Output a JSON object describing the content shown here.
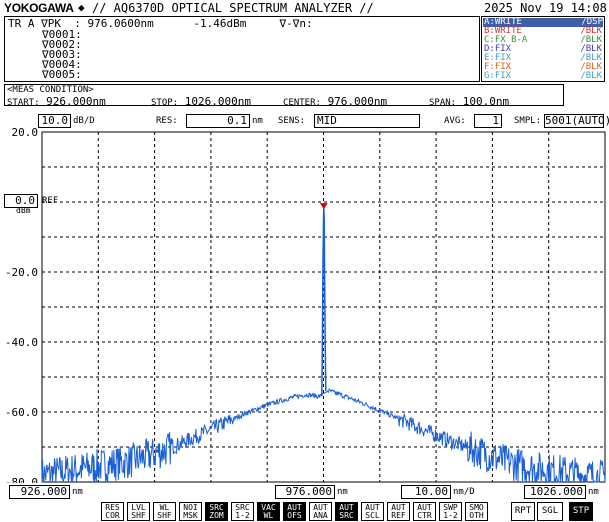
{
  "header": {
    "brand": "YOKOGAWA",
    "title": "// AQ6370D OPTICAL SPECTRUM ANALYZER //",
    "datetime": "2025 Nov 19 14:08"
  },
  "marker": {
    "line1": "TR A ∇PK  : 976.0600nm      -1.46dBm     ∇-∇n:",
    "markers": [
      "∇0001:",
      "∇0002:",
      "∇0003:",
      "∇0004:",
      "∇0005:"
    ]
  },
  "traces": [
    {
      "name": "A:WRITE",
      "mode": "/DSP",
      "color": "#ffffff"
    },
    {
      "name": "B:WRITE",
      "mode": "/BLK",
      "color": "#e03030"
    },
    {
      "name": "C:FX B-A",
      "mode": "/BLK",
      "color": "#3c8f3c"
    },
    {
      "name": "D:FIX",
      "mode": "/BLK",
      "color": "#3c3cc8"
    },
    {
      "name": "E:FIX",
      "mode": "/BLK",
      "color": "#3ca0c8"
    },
    {
      "name": "F:FIX",
      "mode": "/BLK",
      "color": "#e06020"
    },
    {
      "name": "G:FIX",
      "mode": "/BLK",
      "color": "#3ca0c8"
    }
  ],
  "meas": {
    "title": "<MEAS CONDITION>",
    "start_label": "START:",
    "start_value": "926.000",
    "start_unit": "nm",
    "stop_label": "STOP:",
    "stop_value": "1026.000",
    "stop_unit": "nm",
    "center_label": "CENTER:",
    "center_value": "976.000",
    "center_unit": "nm",
    "span_label": "SPAN:",
    "span_value": "100.0",
    "span_unit": "nm"
  },
  "settings": {
    "scale_value": "10.0",
    "scale_unit": "dB/D",
    "res_label": "RES:",
    "res_value": "0.1",
    "res_unit": "nm",
    "sens_label": "SENS:",
    "sens_value": "MID",
    "avg_label": "AVG:",
    "avg_value": "1",
    "smpl_label": "SMPL:",
    "smpl_value": "5001(AUTO)"
  },
  "ref": {
    "value": "0.0",
    "label": "REF",
    "unit": "dBm"
  },
  "bottom": {
    "start": "926.000",
    "start_unit": "nm",
    "center": "976.000",
    "center_unit": "nm",
    "div": "10.00",
    "div_unit": "nm/D",
    "stop": "1026.000",
    "stop_unit": "nm"
  },
  "function_keys": [
    {
      "label": "RES\nCOR",
      "active": false
    },
    {
      "label": "LVL\nSHF",
      "active": false
    },
    {
      "label": "WL\nSHF",
      "active": false
    },
    {
      "label": "NOI\nMSK",
      "active": false
    },
    {
      "label": "SRC\nZOM",
      "active": true
    },
    {
      "label": "SRC\n1-2",
      "active": false
    },
    {
      "label": "VAC\nWL",
      "active": true
    },
    {
      "label": "AUT\nOFS",
      "active": true
    },
    {
      "label": "AUT\nANA",
      "active": false
    },
    {
      "label": "AUT\nSRC",
      "active": true
    },
    {
      "label": "AUT\nSCL",
      "active": false
    },
    {
      "label": "AUT\nREF",
      "active": false
    },
    {
      "label": "AUT\nCTR",
      "active": false
    },
    {
      "label": "SWP\n1-2",
      "active": false
    },
    {
      "label": "SMO\nOTH",
      "active": false
    }
  ],
  "run_keys": [
    {
      "label": "RPT",
      "active": false
    },
    {
      "label": "SGL",
      "active": false
    },
    {
      "label": "STP",
      "active": true
    }
  ],
  "chart_data": {
    "type": "line",
    "xlabel": "nm",
    "ylabel": "dBm",
    "xlim": [
      926.0,
      1026.0
    ],
    "ylim": [
      -80.0,
      20.0
    ],
    "y_ticks": [
      "20.0",
      "0.0",
      "-20.0",
      "-40.0",
      "-60.0",
      "-80.0"
    ],
    "grid": true,
    "peak": {
      "x": 976.06,
      "y": -1.46
    },
    "series": [
      {
        "name": "A",
        "color": "#1a5fd6",
        "points": [
          [
            926.0,
            -78
          ],
          [
            930.0,
            -77
          ],
          [
            934.0,
            -76
          ],
          [
            938.0,
            -75
          ],
          [
            942.0,
            -74
          ],
          [
            946.0,
            -72
          ],
          [
            950.0,
            -69.5
          ],
          [
            954.0,
            -66.5
          ],
          [
            958.0,
            -63.5
          ],
          [
            962.0,
            -60.5
          ],
          [
            966.0,
            -58
          ],
          [
            970.0,
            -56
          ],
          [
            973.0,
            -55
          ],
          [
            975.0,
            -55.5
          ],
          [
            975.7,
            -55.5
          ],
          [
            975.8,
            -40
          ],
          [
            975.9,
            -20
          ],
          [
            976.0,
            -5
          ],
          [
            976.06,
            -1.46
          ],
          [
            976.12,
            -5
          ],
          [
            976.2,
            -20
          ],
          [
            976.3,
            -40
          ],
          [
            976.4,
            -54
          ],
          [
            977.0,
            -54
          ],
          [
            979.0,
            -55
          ],
          [
            983.0,
            -57.5
          ],
          [
            988.0,
            -61
          ],
          [
            993.0,
            -64.5
          ],
          [
            998.0,
            -68
          ],
          [
            1003.0,
            -71
          ],
          [
            1008.0,
            -74
          ],
          [
            1013.0,
            -76
          ],
          [
            1018.0,
            -77
          ],
          [
            1022.0,
            -78
          ],
          [
            1026.0,
            -78.5
          ]
        ]
      }
    ]
  }
}
